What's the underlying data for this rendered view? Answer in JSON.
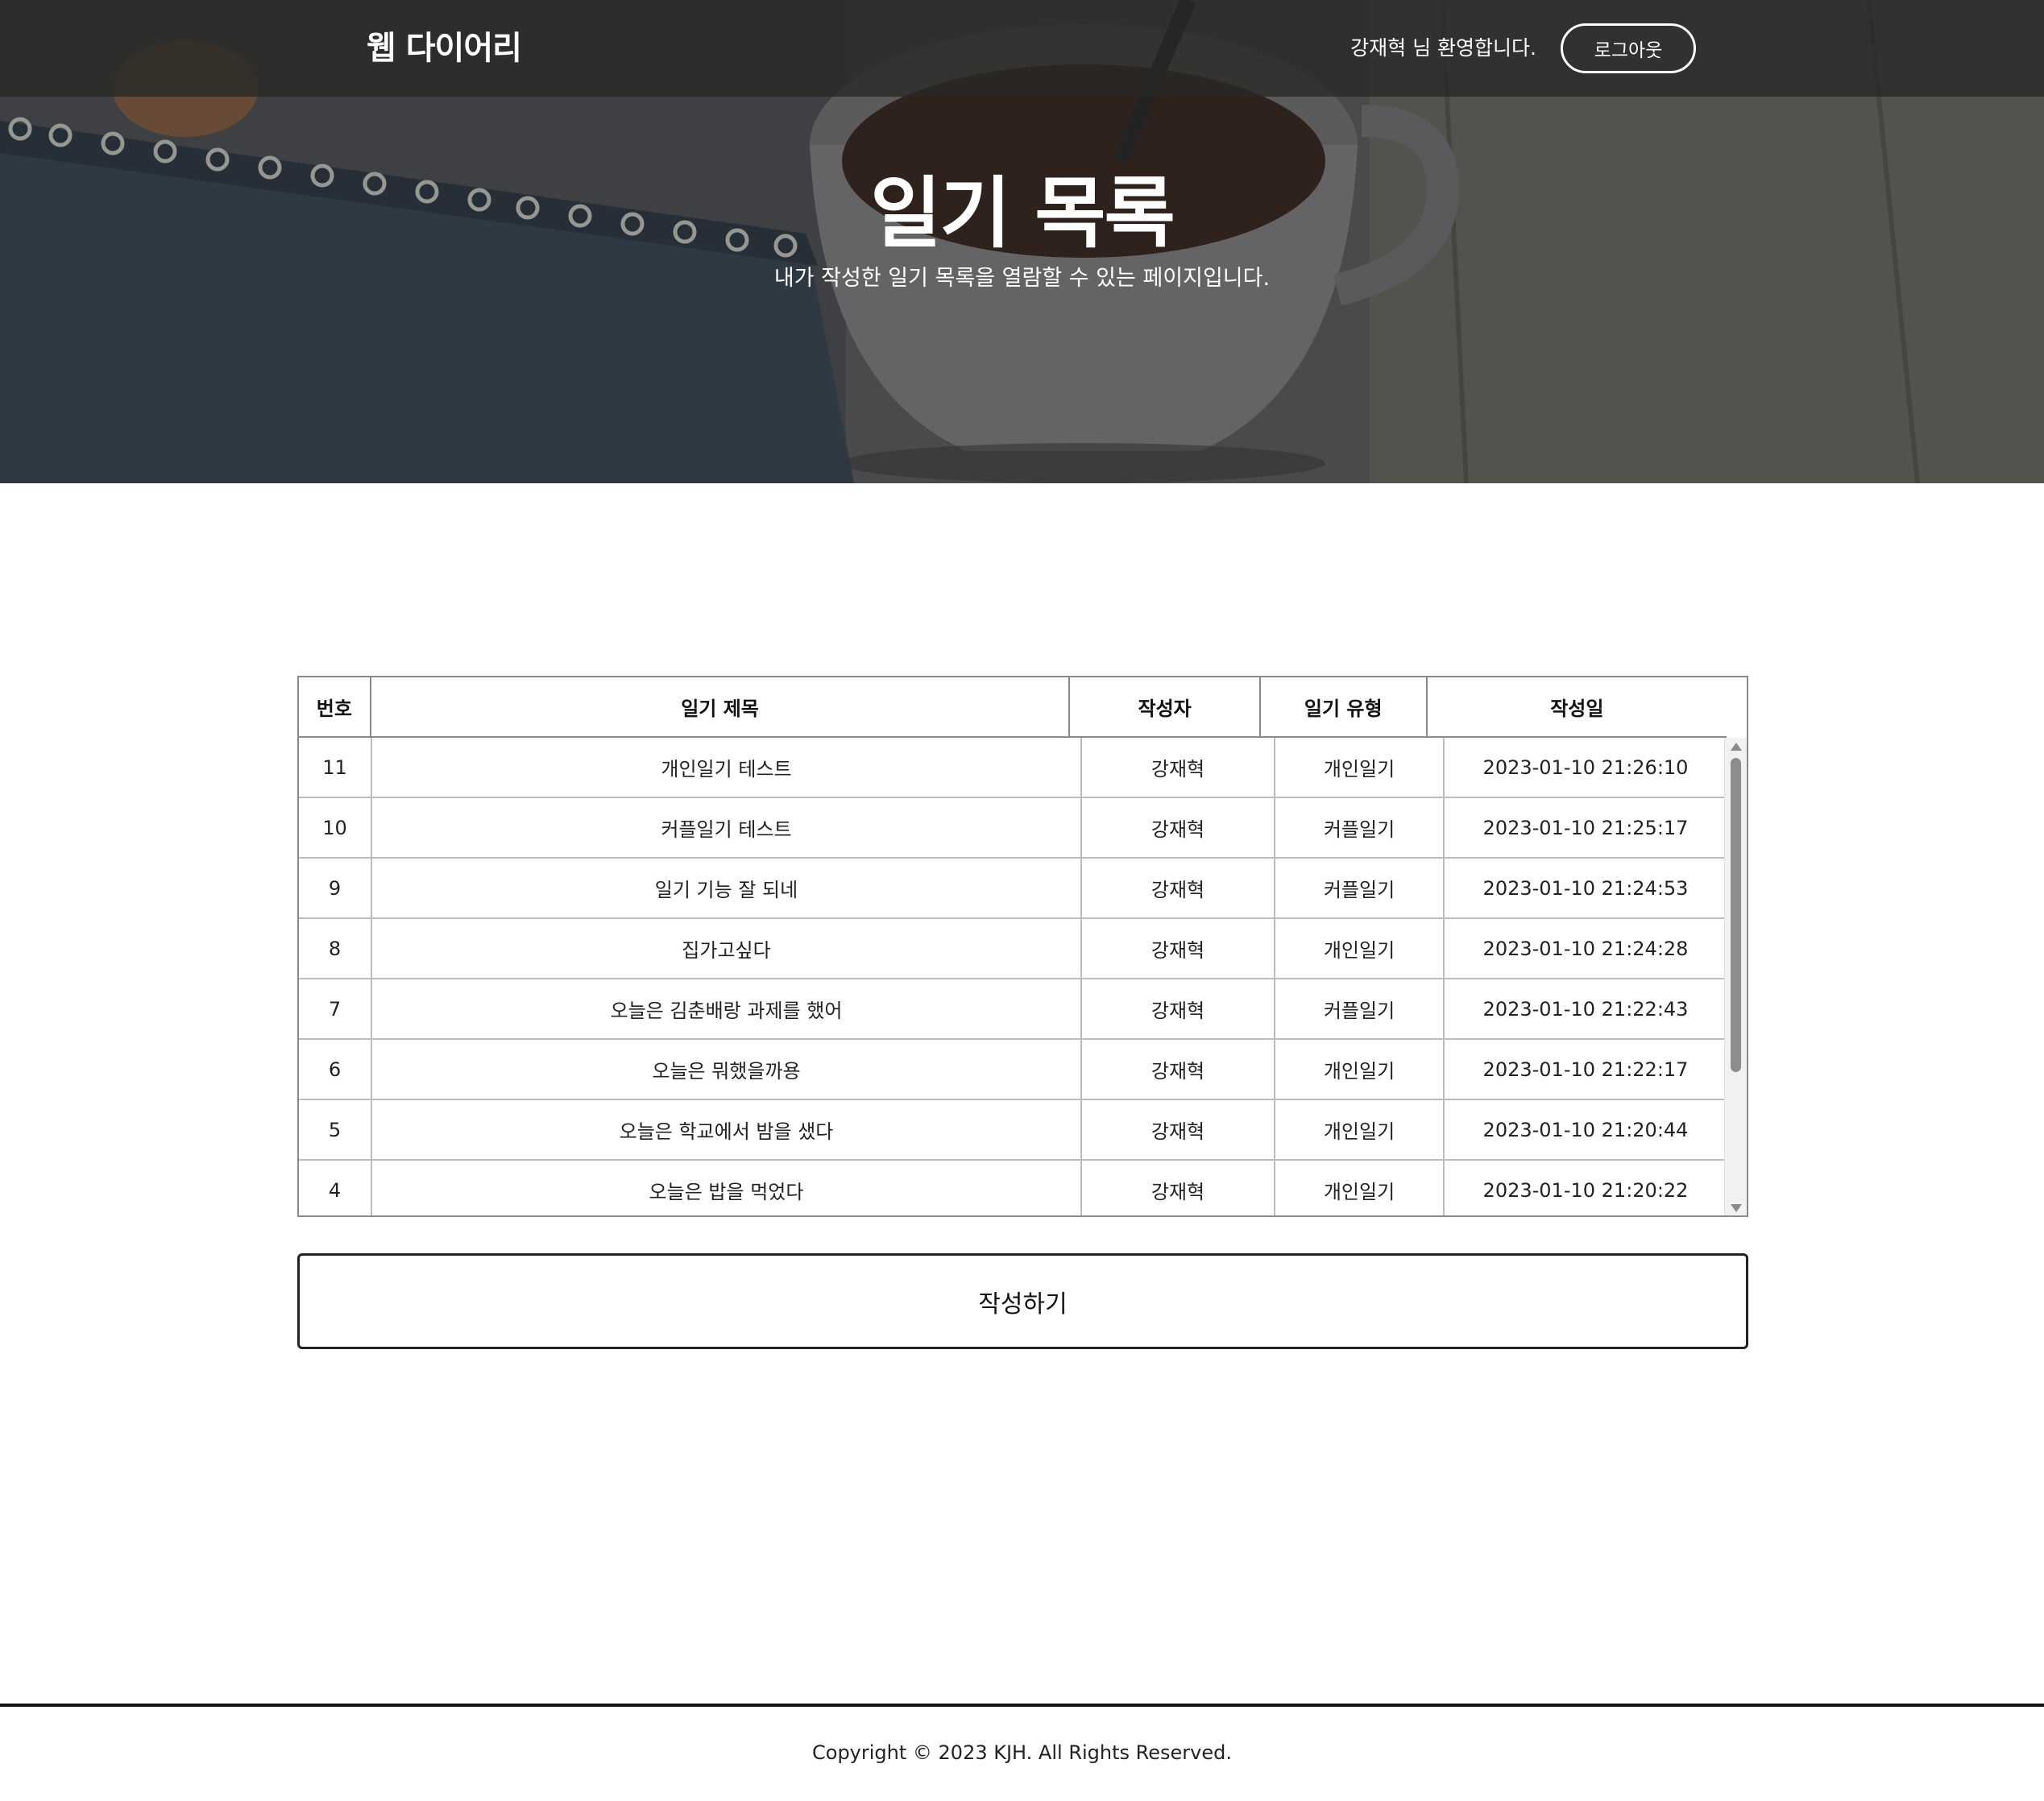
{
  "nav": {
    "brand": "웹 다이어리",
    "welcome": "강재혁 님 환영합니다.",
    "logout_label": "로그아웃"
  },
  "hero": {
    "title": "일기 목록",
    "subtitle": "내가 작성한 일기 목록을 열람할 수 있는 페이지입니다."
  },
  "table": {
    "headers": {
      "no": "번호",
      "title": "일기 제목",
      "author": "작성자",
      "type": "일기 유형",
      "date": "작성일"
    },
    "rows": [
      {
        "no": "11",
        "title": "개인일기 테스트",
        "author": "강재혁",
        "type": "개인일기",
        "date": "2023-01-10 21:26:10"
      },
      {
        "no": "10",
        "title": "커플일기 테스트",
        "author": "강재혁",
        "type": "커플일기",
        "date": "2023-01-10 21:25:17"
      },
      {
        "no": "9",
        "title": "일기 기능 잘 되네",
        "author": "강재혁",
        "type": "커플일기",
        "date": "2023-01-10 21:24:53"
      },
      {
        "no": "8",
        "title": "집가고싶다",
        "author": "강재혁",
        "type": "개인일기",
        "date": "2023-01-10 21:24:28"
      },
      {
        "no": "7",
        "title": "오늘은 김춘배랑 과제를 했어",
        "author": "강재혁",
        "type": "커플일기",
        "date": "2023-01-10 21:22:43"
      },
      {
        "no": "6",
        "title": "오늘은 뭐했을까용",
        "author": "강재혁",
        "type": "개인일기",
        "date": "2023-01-10 21:22:17"
      },
      {
        "no": "5",
        "title": "오늘은 학교에서 밤을 샜다",
        "author": "강재혁",
        "type": "개인일기",
        "date": "2023-01-10 21:20:44"
      },
      {
        "no": "4",
        "title": "오늘은 밥을 먹었다",
        "author": "강재혁",
        "type": "개인일기",
        "date": "2023-01-10 21:20:22"
      }
    ]
  },
  "actions": {
    "write_label": "작성하기"
  },
  "footer": {
    "copyright": "Copyright © 2023 KJH. All Rights Reserved."
  }
}
